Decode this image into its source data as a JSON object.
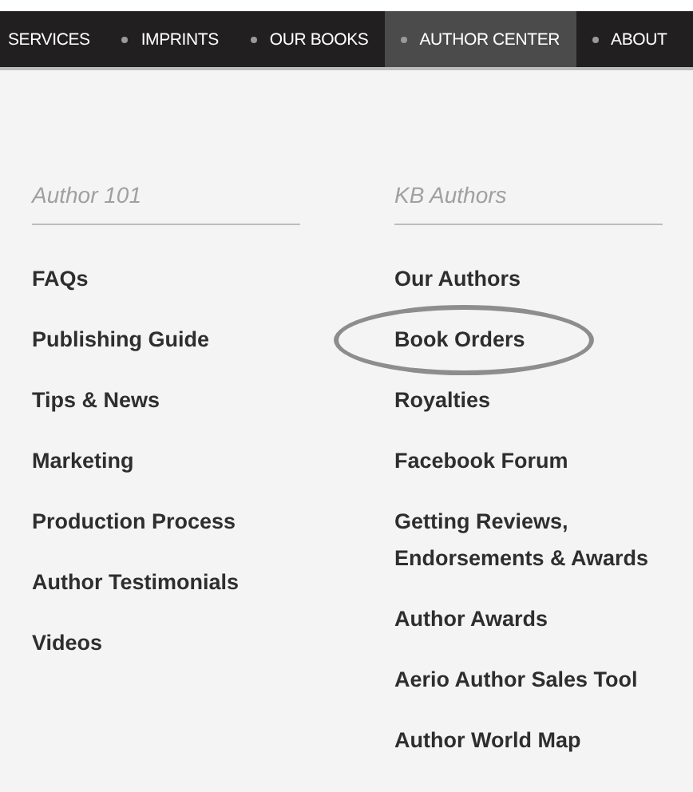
{
  "nav": [
    {
      "label": "SERVICES",
      "selected": false
    },
    {
      "label": "IMPRINTS",
      "selected": false
    },
    {
      "label": "OUR BOOKS",
      "selected": false
    },
    {
      "label": "AUTHOR CENTER",
      "selected": true
    },
    {
      "label": "ABOUT",
      "selected": false
    }
  ],
  "columns": [
    {
      "heading": "Author 101",
      "items": [
        {
          "label": "FAQs",
          "circled": false
        },
        {
          "label": "Publishing Guide",
          "circled": false
        },
        {
          "label": "Tips & News",
          "circled": false
        },
        {
          "label": "Marketing",
          "circled": false
        },
        {
          "label": "Production Process",
          "circled": false
        },
        {
          "label": "Author Testimonials",
          "circled": false
        },
        {
          "label": "Videos",
          "circled": false
        }
      ]
    },
    {
      "heading": "KB Authors",
      "items": [
        {
          "label": "Our Authors",
          "circled": false
        },
        {
          "label": "Book Orders",
          "circled": true
        },
        {
          "label": "Royalties",
          "circled": false
        },
        {
          "label": "Facebook Forum",
          "circled": false
        },
        {
          "label": "Getting Reviews, Endorsements & Awards",
          "circled": false
        },
        {
          "label": "Author Awards",
          "circled": false
        },
        {
          "label": "Aerio Author Sales Tool",
          "circled": false
        },
        {
          "label": "Author World Map",
          "circled": false
        }
      ]
    }
  ]
}
